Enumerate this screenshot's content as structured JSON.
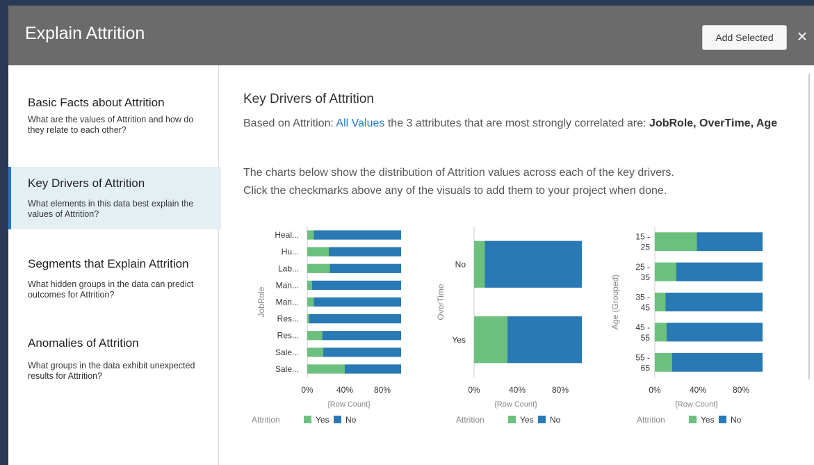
{
  "dialog": {
    "title": "Explain Attrition",
    "add_selected_label": "Add Selected",
    "close_glyph": "×"
  },
  "sidebar": {
    "items": [
      {
        "title": "Basic Facts about Attrition",
        "desc": "What are the values of Attrition and how do they relate to each other?"
      },
      {
        "title": "Key Drivers of Attrition",
        "desc": "What elements in this data best explain the values of Attrition?"
      },
      {
        "title": "Segments that Explain Attrition",
        "desc": "What hidden groups in the data can predict outcomes for Attrition?"
      },
      {
        "title": "Anomalies of Attrition",
        "desc": "What groups in the data exhibit unexpected results for Attrition?"
      }
    ]
  },
  "main": {
    "title": "Key Drivers of Attrition",
    "intro_prefix": "Based on Attrition:",
    "intro_link": "All Values",
    "intro_mid": "the 3 attributes that are most strongly correlated are:",
    "intro_bold": "JobRole, OverTime, Age",
    "desc_line1": "The charts below show the distribution of Attrition values across each of the key drivers.",
    "desc_line2": "Click the checkmarks above any of the visuals to add them to your project when done."
  },
  "colors": {
    "yes": "#6cc07e",
    "no": "#2979b5",
    "accent": "#2176c7"
  },
  "chart_data": [
    {
      "type": "bar",
      "orientation": "horizontal",
      "stacked": true,
      "ylabel": "JobRole",
      "xlabel": "{Row Count}",
      "categories": [
        "Heal...",
        "Hu...",
        "Lab...",
        "Man...",
        "Man...",
        "Res...",
        "Res...",
        "Sale...",
        "Sale..."
      ],
      "series": [
        {
          "name": "Yes",
          "values": [
            7,
            23,
            24,
            5,
            7,
            2,
            16,
            17,
            40
          ]
        },
        {
          "name": "No",
          "values": [
            93,
            77,
            76,
            95,
            93,
            98,
            84,
            83,
            60
          ]
        }
      ],
      "xticks": [
        "0%",
        "40%",
        "80%"
      ],
      "xlim": [
        0,
        100
      ],
      "legend_title": "Attrition",
      "legend": [
        "Yes",
        "No"
      ]
    },
    {
      "type": "bar",
      "orientation": "horizontal",
      "stacked": true,
      "ylabel": "OverTime",
      "xlabel": "{Row Count}",
      "categories": [
        "No",
        "Yes"
      ],
      "series": [
        {
          "name": "Yes",
          "values": [
            10,
            31
          ]
        },
        {
          "name": "No",
          "values": [
            90,
            69
          ]
        }
      ],
      "xticks": [
        "0%",
        "40%",
        "80%"
      ],
      "xlim": [
        0,
        100
      ],
      "legend_title": "Attrition",
      "legend": [
        "Yes",
        "No"
      ]
    },
    {
      "type": "bar",
      "orientation": "horizontal",
      "stacked": true,
      "ylabel": "Age (Grouped)",
      "xlabel": "{Row Count}",
      "categories": [
        "15 - 25",
        "25 - 35",
        "35 - 45",
        "45 - 55",
        "55 - 65"
      ],
      "series": [
        {
          "name": "Yes",
          "values": [
            39,
            20,
            10,
            11,
            16
          ]
        },
        {
          "name": "No",
          "values": [
            61,
            80,
            90,
            89,
            84
          ]
        }
      ],
      "xticks": [
        "0%",
        "40%",
        "80%"
      ],
      "xlim": [
        0,
        100
      ],
      "legend_title": "Attrition",
      "legend": [
        "Yes",
        "No"
      ]
    }
  ]
}
